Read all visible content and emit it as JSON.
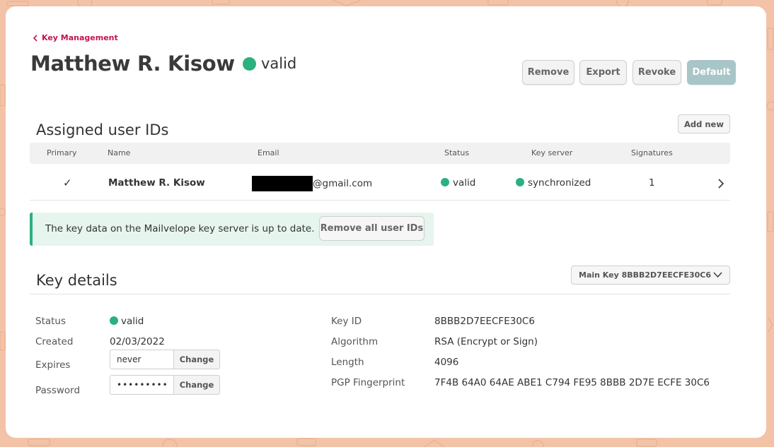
{
  "colors": {
    "accent": "#c5134f",
    "valid_green": "#2bb07f",
    "default_button": "#a8c5c8"
  },
  "header": {
    "back_label": "Key Management",
    "name": "Matthew R. Kisow",
    "status": "valid"
  },
  "toolbar": {
    "remove_label": "Remove",
    "export_label": "Export",
    "revoke_label": "Revoke",
    "default_label": "Default"
  },
  "user_ids": {
    "section_title": "Assigned user IDs",
    "add_new_label": "Add new",
    "columns": [
      "Primary",
      "Name",
      "Email",
      "Status",
      "Key server",
      "Signatures"
    ],
    "rows": [
      {
        "primary": "✓",
        "name": "Matthew R. Kisow",
        "email_suffix": "@gmail.com",
        "status": "valid",
        "key_server": "synchronized",
        "signatures": "1",
        "icon": "chevron-right-icon"
      }
    ]
  },
  "alert": {
    "message": "The key data on the Mailvelope key server is up to date.",
    "button_label": "Remove all user IDs"
  },
  "key_details": {
    "section_title": "Key details",
    "key_select": "Main Key 8BBB2D7EECFE30C6",
    "left": {
      "status_label": "Status",
      "status_value": "valid",
      "created_label": "Created",
      "created_value": "02/03/2022",
      "expires_label": "Expires",
      "expires_value": "never",
      "password_label": "Password",
      "password_value": "•••••••••",
      "change_label": "Change"
    },
    "right": {
      "keyid_label": "Key ID",
      "keyid_value": "8BBB2D7EECFE30C6",
      "algorithm_label": "Algorithm",
      "algorithm_value": "RSA (Encrypt or Sign)",
      "length_label": "Length",
      "length_value": "4096",
      "fingerprint_label": "PGP Fingerprint",
      "fingerprint_value": "7F4B 64A0 64AE ABE1 C794 FE95 8BBB 2D7E ECFE 30C6"
    }
  }
}
